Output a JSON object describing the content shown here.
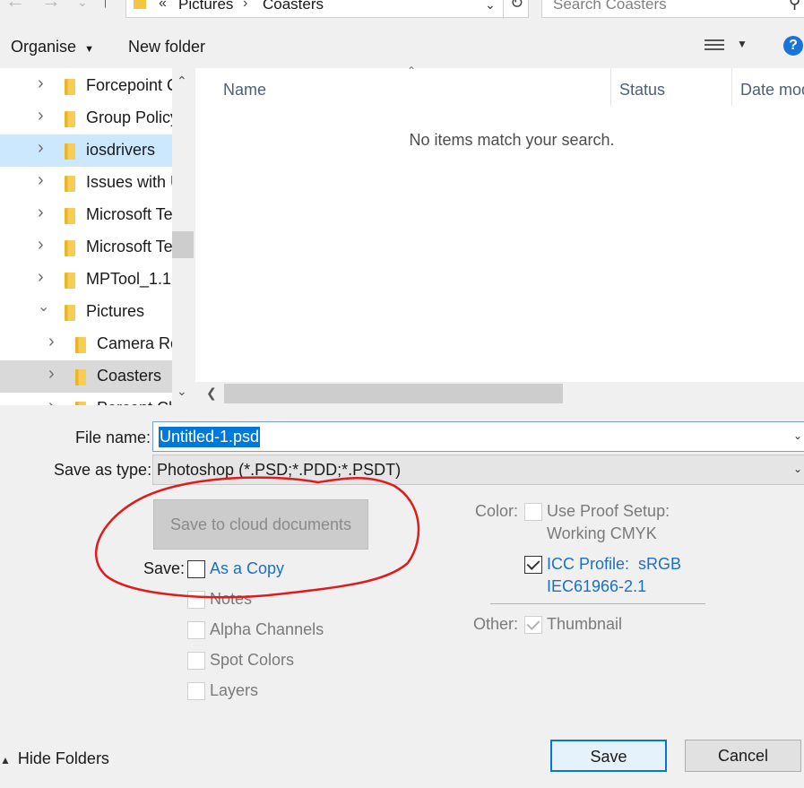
{
  "address": {
    "crumbs": [
      "Pictures",
      "Coasters"
    ],
    "overflow_chevron": "«",
    "separator": "›",
    "search_placeholder": "Search Coasters"
  },
  "toolbar": {
    "organise_label": "Organise",
    "new_folder_label": "New folder",
    "help_label": "?"
  },
  "nav_tree": {
    "items": [
      {
        "label": "Forcepoint C",
        "state": "normal",
        "expanded": false,
        "level": 0
      },
      {
        "label": "Group Policy",
        "state": "normal",
        "expanded": false,
        "level": 0
      },
      {
        "label": "iosdrivers",
        "state": "selected",
        "expanded": false,
        "level": 0
      },
      {
        "label": "Issues with U",
        "state": "normal",
        "expanded": false,
        "level": 0
      },
      {
        "label": "Microsoft Te",
        "state": "normal",
        "expanded": false,
        "level": 0
      },
      {
        "label": "Microsoft Te",
        "state": "normal",
        "expanded": false,
        "level": 0
      },
      {
        "label": "MPTool_1.1.",
        "state": "normal",
        "expanded": false,
        "level": 0
      },
      {
        "label": "Pictures",
        "state": "normal",
        "expanded": true,
        "level": 0
      },
      {
        "label": "Camera Ro",
        "state": "normal",
        "expanded": false,
        "level": 1
      },
      {
        "label": "Coasters",
        "state": "current",
        "expanded": false,
        "level": 1
      },
      {
        "label": "Percept Ch",
        "state": "normal",
        "expanded": false,
        "level": 1
      }
    ]
  },
  "file_list": {
    "columns": [
      "Name",
      "Status",
      "Date mod"
    ],
    "empty_message": "No items match your search."
  },
  "form": {
    "file_name_label": "File name:",
    "file_name_value": "Untitled-1.psd",
    "save_as_type_label": "Save as type:",
    "save_as_type_value": "Photoshop (*.PSD;*.PDD;*.PSDT)"
  },
  "options": {
    "cloud_button_label": "Save to cloud documents",
    "save_label": "Save:",
    "save_items": [
      {
        "label": "As a Copy",
        "checked": false,
        "enabled": true
      },
      {
        "label": "Notes",
        "checked": false,
        "enabled": false
      },
      {
        "label": "Alpha Channels",
        "checked": false,
        "enabled": false
      },
      {
        "label": "Spot Colors",
        "checked": false,
        "enabled": false
      },
      {
        "label": "Layers",
        "checked": false,
        "enabled": false
      }
    ],
    "color_label": "Color:",
    "use_proof_line1": "Use Proof Setup:",
    "use_proof_line2": "Working CMYK",
    "use_proof_checked": false,
    "icc_line1": "ICC Profile:  sRGB",
    "icc_line2": "IEC61966-2.1",
    "icc_checked": true,
    "other_label": "Other:",
    "thumbnail_label": "Thumbnail",
    "thumbnail_checked": true
  },
  "footer": {
    "hide_folders_label": "Hide Folders",
    "save_button": "Save",
    "cancel_button": "Cancel"
  },
  "colors": {
    "accent": "#0078d7",
    "link": "#1a6fc9",
    "annotation": "#e01b1b",
    "selected_row": "#cce8ff"
  }
}
